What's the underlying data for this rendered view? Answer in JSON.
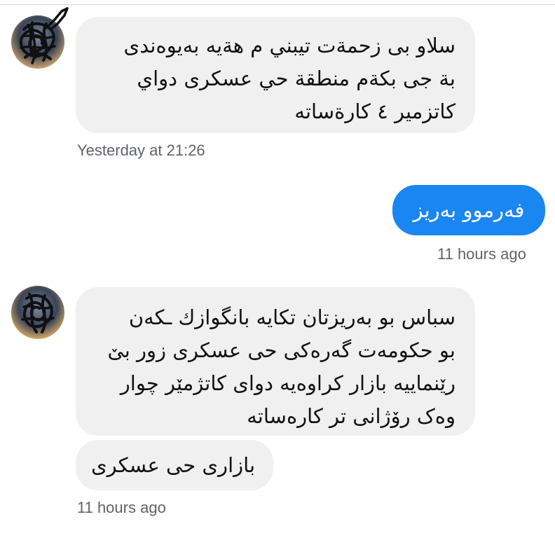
{
  "messages": {
    "msg1": {
      "lines": [
        "سلاو بی زحمةت تيبني م هةيە بەيوەندى",
        "بة جى بكةم منطقة حي عسكرى دواي",
        "كاتزمير ٤ كارةساته"
      ],
      "timestamp": "Yesterday at 21:26"
    },
    "msg2": {
      "text": "فەرموو بەريز",
      "timestamp": "11 hours ago"
    },
    "msg3": {
      "lines": [
        "سباس بو بەريزتان تكايه بانگوازك ـكەن",
        "بو حكومەت گەرەكی حی عسكرى زور بێ",
        "رێنماييه بازار كراوەيه دواى كاتژمێر چوار",
        "وەک رۆژانی تر كارەساتە"
      ]
    },
    "msg4": {
      "text": "بازارى حى عسكرى",
      "timestamp": "11 hours ago"
    }
  },
  "colors": {
    "incoming_bubble": "#f0f0f0",
    "outgoing_bubble": "#1a86f2",
    "timestamp_text": "#5f6368"
  }
}
